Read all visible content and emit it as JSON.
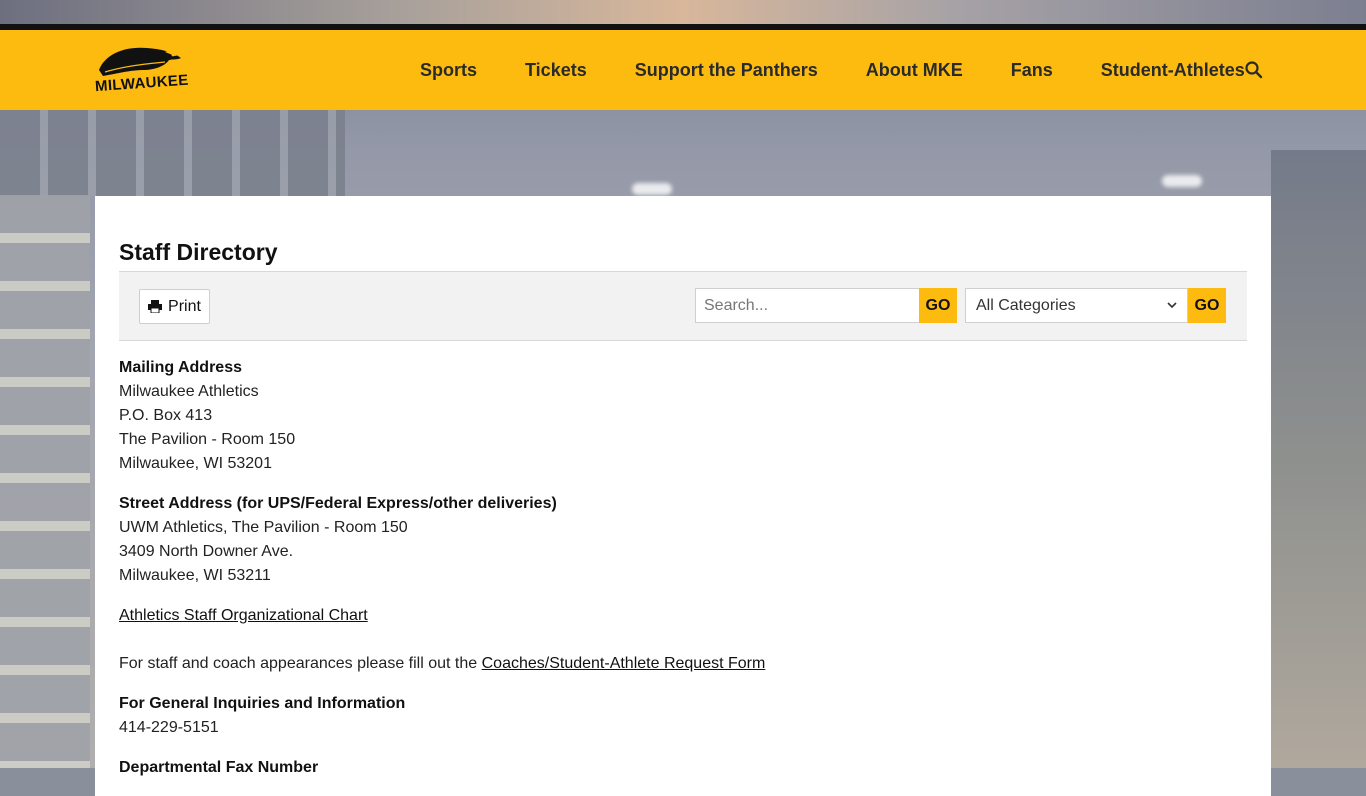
{
  "nav": {
    "items": [
      "Sports",
      "Tickets",
      "Support the Panthers",
      "About MKE",
      "Fans",
      "Student-Athletes"
    ],
    "logo_text": "MILWAUKEE",
    "search_icon": "search-icon"
  },
  "page": {
    "title": "Staff Directory"
  },
  "toolbar": {
    "print_label": "Print",
    "search_placeholder": "Search...",
    "go_label": "GO",
    "category_selected": "All Categories"
  },
  "content": {
    "mailing_heading": "Mailing Address",
    "mailing_lines": [
      "Milwaukee Athletics",
      "P.O. Box 413",
      "The Pavilion - Room 150",
      "Milwaukee, WI 53201"
    ],
    "street_heading": "Street Address (for UPS/Federal Express/other deliveries)",
    "street_lines": [
      "UWM Athletics, The Pavilion - Room 150",
      "3409 North Downer Ave.",
      "Milwaukee, WI 53211"
    ],
    "org_chart_link": "Athletics Staff Organizational Chart",
    "appearance_text": "For staff and coach appearances please fill out the ",
    "appearance_link": "Coaches/Student-Athlete Request Form",
    "inquiries_heading": "For General Inquiries and Information",
    "inquiries_phone": "414-229-5151",
    "fax_heading": "Departmental Fax Number"
  },
  "colors": {
    "brand_gold": "#fdbb10",
    "text": "#111111"
  }
}
